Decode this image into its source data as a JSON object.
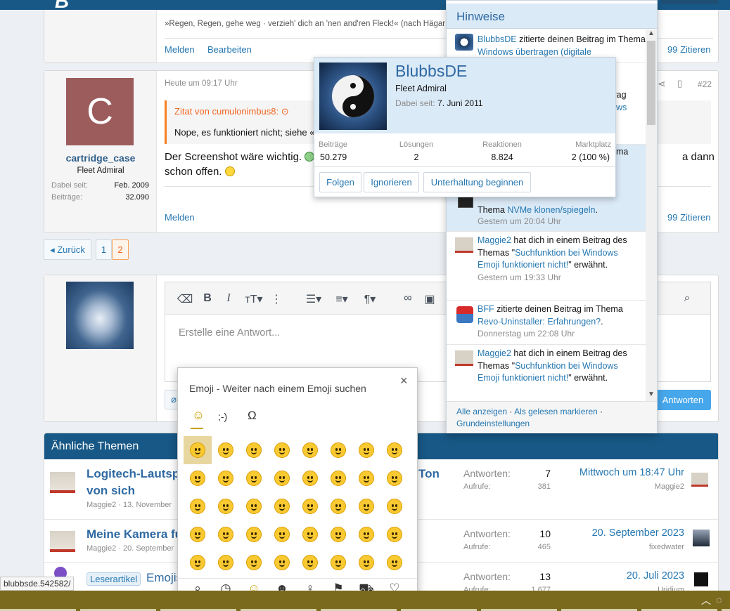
{
  "post_prev": {
    "quote_text": "»Regen, Regen, gehe weg · verzieh' dich an 'nen and'ren Fleck!« (nach Hägar",
    "report": "Melden",
    "edit": "Bearbeiten",
    "quote": "Zitieren"
  },
  "post": {
    "time": "Heute um 09:17 Uhr",
    "number": "#22",
    "avatar_letter": "C",
    "username": "cartridge_case",
    "title": "Fleet Admiral",
    "joined_label": "Dabei seit:",
    "joined_value": "Feb. 2009",
    "posts_label": "Beiträge:",
    "posts_value": "32.090",
    "quote_head": "Zitat von cumulonimbus8:",
    "quote_body": "Nope, es funktioniert nicht; siehe «",
    "body_line1": "Der Screenshot wäre wichtig.",
    "body_line1_tail": "a dann",
    "body_line2": "schon offen.",
    "report": "Melden",
    "quote": "Zitieren"
  },
  "pagination": {
    "back": "Zurück",
    "pages": [
      "1",
      "2"
    ]
  },
  "editor": {
    "placeholder": "Erstelle eine Antwort...",
    "submit": "Antworten"
  },
  "emoji_picker": {
    "title": "Emoji - Weiter nach einem Emoji suchen",
    "tabs": [
      "☺",
      ";-)",
      "Ω"
    ],
    "rows": 5,
    "cols": 8,
    "bottom_tabs": [
      "search-icon",
      "clock-icon",
      "smiley-icon",
      "people-icon",
      "balloon-icon",
      "flag-icon",
      "car-icon",
      "heart-icon"
    ]
  },
  "similar": {
    "heading": "Ähnliche Themen",
    "threads": [
      {
        "title_a": "Logitech-Lautspr",
        "title_b": "Ton",
        "title_c": "von sich",
        "author": "Maggie2 · 13. November",
        "replies_label": "Antworten:",
        "replies": "7",
        "views_label": "Aufrufe:",
        "views": "381",
        "last_date": "Mittwoch um 18:47 Uhr",
        "last_user": "Maggie2"
      },
      {
        "title_a": "Meine Kamera fu",
        "author": "Maggie2 · 20. September",
        "replies_label": "Antworten:",
        "replies": "10",
        "views_label": "Aufrufe:",
        "views": "465",
        "last_date": "20. September 2023",
        "last_user": "fixedwater"
      },
      {
        "prefix": "Leserartikel",
        "title_a": "Emojis",
        "replies_label": "Antworten:",
        "replies": "13",
        "views_label": "Aufrufe:",
        "views": "1.677",
        "last_date": "20. Juli 2023",
        "last_user": "Uridium"
      }
    ]
  },
  "profile_card": {
    "name": "BlubbsDE",
    "title": "Fleet Admiral",
    "joined_label": "Dabei seit:",
    "joined_value": "7. Juni 2011",
    "stats": [
      {
        "label": "Beiträge",
        "value": "50.279"
      },
      {
        "label": "Lösungen",
        "value": "2"
      },
      {
        "label": "Reaktionen",
        "value": "8.824"
      },
      {
        "label": "Marktplatz",
        "value": "2 (100 %)"
      }
    ],
    "follow": "Folgen",
    "ignore": "Ignorieren",
    "start_convo": "Unterhaltung beginnen"
  },
  "notifications": {
    "title": "Hinweise",
    "items": [
      {
        "user": "BlubbsDE",
        "text": " zitierte deinen Beitrag im Thema ",
        "link": "Windows übertragen (digitale",
        "time": ""
      },
      {
        "user": "",
        "text": "Thema ",
        "link": "NVMe klonen/spiegeln",
        "tail": ".",
        "time": "Gestern um 20:04 Uhr"
      },
      {
        "user": "Maggie2",
        "text": " hat dich in einem Beitrag des Themas \"",
        "link": "Suchfunktion bei Windows Emoji funktioniert nicht!",
        "tail": "\" erwähnt.",
        "time": "Gestern um 19:33 Uhr"
      },
      {
        "user": "BFF",
        "text": " zitierte deinen Beitrag im Thema ",
        "link": "Revo-Uninstaller: Erfahrungen?",
        "tail": ".",
        "time": "Donnerstag um 22:08 Uhr"
      },
      {
        "user": "Maggie2",
        "text": " hat dich in einem Beitrag des Themas \"",
        "link": "Suchfunktion bei Windows Emoji funktioniert nicht!",
        "tail": "\" erwähnt.",
        "time": ""
      }
    ],
    "partial_1": "trag",
    "partial_2": "ows",
    "partial_3": "ema",
    "show_all": "Alle anzeigen",
    "mark_read": "Als gelesen markieren",
    "prefs": "Grundeinstellungen"
  },
  "statusbar": {
    "url": "blubbsde.542582/"
  },
  "colors": {
    "accent": "#2577b1",
    "header": "#185886",
    "quote": "#f87f1d",
    "taskbar": "#7a6a1e"
  }
}
